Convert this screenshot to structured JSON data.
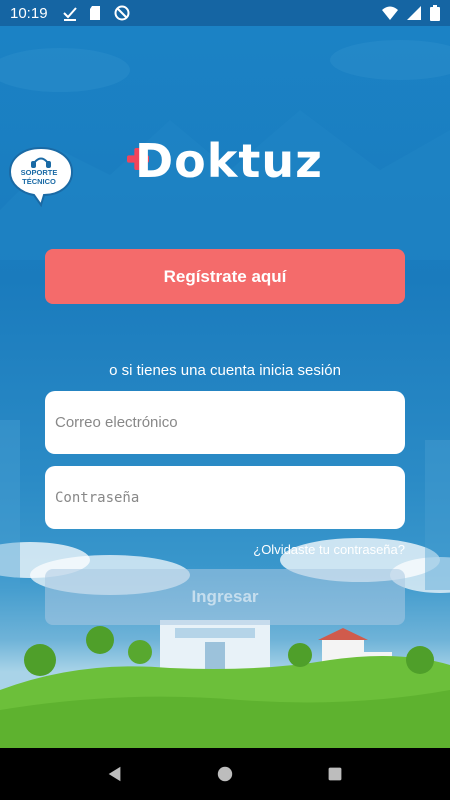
{
  "status_bar": {
    "time": "10:19",
    "icons_left": [
      "check-download-icon",
      "sd-card-icon",
      "dnd-icon"
    ],
    "icons_right": [
      "wifi-icon",
      "signal-icon",
      "battery-icon"
    ]
  },
  "logo": {
    "text": "Doktuz",
    "accent_color": "#f2445a"
  },
  "support": {
    "line1": "SOPORTE",
    "line2": "TÉCNICO"
  },
  "register_button": {
    "label": "Regístrate aquí"
  },
  "or_text": "o si tienes una cuenta inicia sesión",
  "email_field": {
    "placeholder": "Correo electrónico",
    "value": ""
  },
  "password_field": {
    "placeholder": "Contraseña",
    "value": ""
  },
  "forgot_link": "¿Olvidaste tu contraseña?",
  "login_button": {
    "label": "Ingresar"
  },
  "nav": {
    "back": "back-icon",
    "home": "home-icon",
    "recents": "recents-icon"
  },
  "colors": {
    "primary_bg": "#1b7bbd",
    "register": "#f46b6b",
    "status_bar": "#1565a3"
  }
}
